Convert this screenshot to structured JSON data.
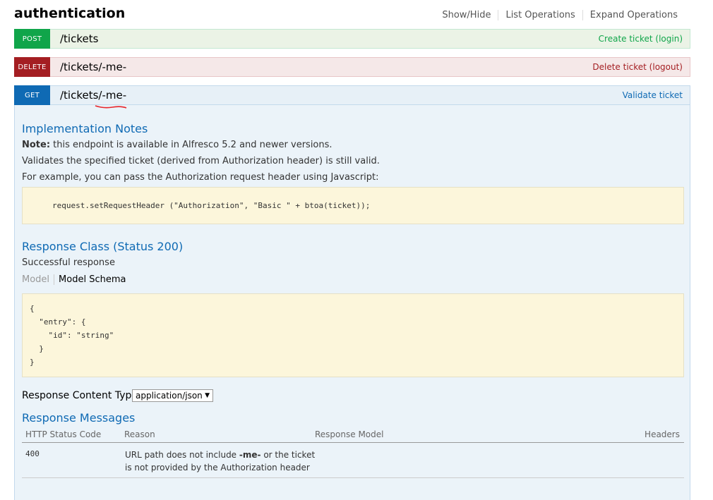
{
  "section_title": "authentication",
  "header_links": [
    "Show/Hide",
    "List Operations",
    "Expand Operations"
  ],
  "operations": [
    {
      "method": "POST",
      "path": "/tickets",
      "summary": "Create ticket (login)"
    },
    {
      "method": "DELETE",
      "path": "/tickets/-me-",
      "summary": "Delete ticket (logout)"
    },
    {
      "method": "GET",
      "path": "/tickets/-me-",
      "summary": "Validate ticket"
    }
  ],
  "impl_notes": {
    "heading": "Implementation Notes",
    "note_label": "Note:",
    "note_text": " this endpoint is available in Alfresco 5.2 and newer versions.",
    "line2": "Validates the specified ticket (derived from Authorization header) is still valid.",
    "line3": "For example, you can pass the Authorization request header using Javascript:",
    "code": "request.setRequestHeader (\"Authorization\", \"Basic \" + btoa(ticket));"
  },
  "response_class": {
    "heading": "Response Class (Status 200)",
    "description": "Successful response",
    "tab_model": "Model",
    "tab_schema": "Model Schema",
    "schema_lines": [
      "{",
      "  \"entry\": {",
      "    \"id\": \"string\"",
      "  }",
      "}"
    ]
  },
  "content_type": {
    "label": "Response Content Type",
    "selected": "application/json"
  },
  "response_messages": {
    "heading": "Response Messages",
    "columns": [
      "HTTP Status Code",
      "Reason",
      "Response Model",
      "Headers"
    ],
    "rows": [
      {
        "code": "400",
        "reason_pre": "URL path does not include ",
        "reason_bold": "-me-",
        "reason_post": " or the ticket",
        "reason_line2": "is not provided by the Authorization header"
      }
    ]
  },
  "colors": {
    "post": "#10a54a",
    "delete": "#a41e22",
    "get": "#0f6ab4",
    "code_bg": "#fcf6db"
  }
}
